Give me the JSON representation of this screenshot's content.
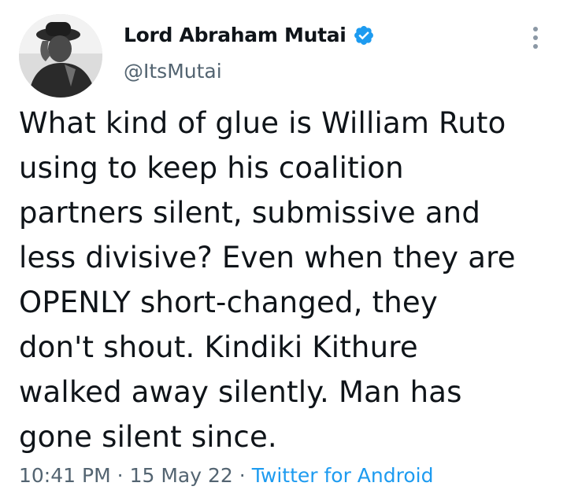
{
  "author": {
    "display_name": "Lord Abraham Mutai",
    "handle": "@ItsMutai",
    "verified": true,
    "avatar_icon": "profile-photo"
  },
  "tweet": {
    "text": "What kind of glue is William Ruto\nusing to keep his coalition\npartners silent, submissive and\nless divisive? Even when they are\nOPENLY short-changed, they\ndon't shout. Kindiki Kithure\nwalked away silently. Man has\ngone silent since."
  },
  "meta": {
    "time": "10:41 PM",
    "separator": "·",
    "date": "15 May 22",
    "source": "Twitter for Android"
  },
  "icons": {
    "verified": "verified-badge-icon",
    "more": "more-options-icon"
  },
  "colors": {
    "text_primary": "#0f1419",
    "text_secondary": "#536471",
    "accent": "#1d9bf0"
  }
}
